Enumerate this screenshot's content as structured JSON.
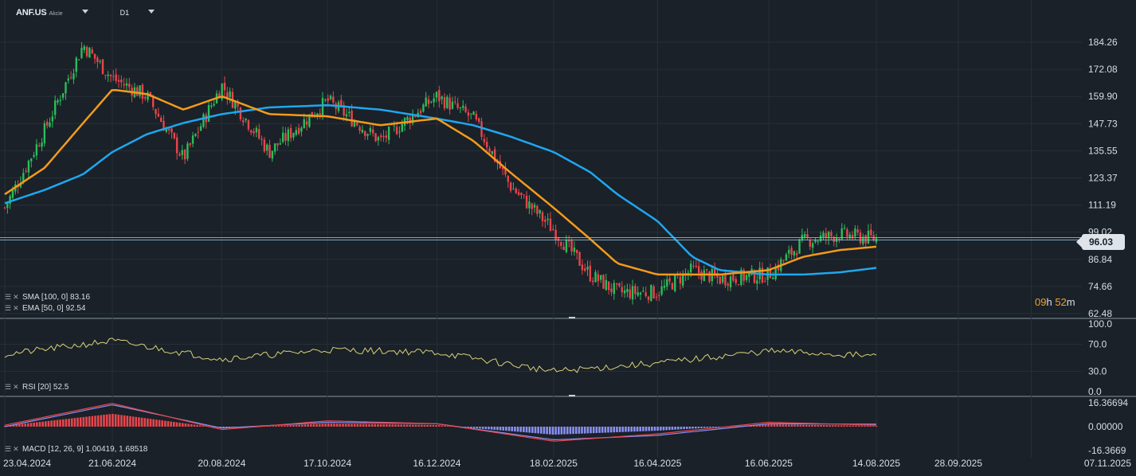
{
  "header": {
    "symbol": "ANF.US",
    "symbol_type": "Akcie",
    "timeframe": "D1"
  },
  "price_panel": {
    "y_ticks": [
      "184.26",
      "172.08",
      "159.90",
      "147.73",
      "135.55",
      "123.37",
      "111.19",
      "99.02",
      "86.84",
      "74.66",
      "62.48"
    ],
    "y_tick_values": [
      184.26,
      172.08,
      159.9,
      147.73,
      135.55,
      123.37,
      111.19,
      99.02,
      86.84,
      74.66,
      62.48
    ],
    "current_price": "96.03",
    "current_price_value": 96.03,
    "countdown_h": "09",
    "countdown_h_unit": "h",
    "countdown_m": "52",
    "countdown_m_unit": "m",
    "sma_label": "SMA [100, 0] 83.16",
    "ema_label": "EMA [50, 0] 92.54"
  },
  "rsi_panel": {
    "y_ticks": [
      "100.0",
      "70.0",
      "30.0",
      "0.0"
    ],
    "y_tick_values": [
      100,
      70,
      30,
      0
    ],
    "label": "RSI [20] 52.5"
  },
  "macd_panel": {
    "y_ticks": [
      "16.36694",
      "0.00000",
      "-16.3669"
    ],
    "y_tick_values": [
      16.36694,
      0,
      -16.3669
    ],
    "label": "MACD [12, 26, 9] 1.00419, 1.68518"
  },
  "x_ticks": [
    "23.04.2024",
    "21.06.2024",
    "20.08.2024",
    "17.10.2024",
    "16.12.2024",
    "18.02.2025",
    "16.04.2025",
    "16.06.2025",
    "14.08.2025",
    "28.09.2025",
    "07.11.2025"
  ],
  "colors": {
    "background": "#1a2128",
    "grid": "#263039",
    "up": "#2bbd5a",
    "down": "#e8454c",
    "sma": "#1ea7f0",
    "ema": "#f39a1c",
    "rsi": "#d8d27a",
    "macd_line": "#e8454c",
    "signal_line": "#8a8ff0",
    "hist_pos": "#e8454c",
    "hist_neg": "#8a8ff0",
    "countdown": "#f0a030"
  },
  "chart_data": [
    {
      "type": "line",
      "panel": "price",
      "x": [
        "2024-04-23",
        "2024-05-15",
        "2024-06-05",
        "2024-06-21",
        "2024-07-10",
        "2024-07-30",
        "2024-08-20",
        "2024-09-15",
        "2024-10-17",
        "2024-11-15",
        "2024-12-16",
        "2025-01-05",
        "2025-01-25",
        "2025-02-18",
        "2025-03-10",
        "2025-03-25",
        "2025-04-16",
        "2025-05-05",
        "2025-05-20",
        "2025-06-16",
        "2025-07-05",
        "2025-07-25",
        "2025-08-14"
      ],
      "series": [
        {
          "name": "Close",
          "values": [
            110,
            145,
            183,
            168,
            160,
            132,
            165,
            135,
            158,
            140,
            160,
            150,
            120,
            100,
            80,
            72,
            72,
            82,
            78,
            80,
            95,
            98,
            96
          ]
        },
        {
          "name": "SMA [100, 0]",
          "values": [
            112,
            118,
            125,
            135,
            143,
            148,
            152,
            155,
            156,
            154,
            150,
            147,
            142,
            135,
            126,
            116,
            104,
            88,
            82,
            80,
            80,
            81,
            83
          ]
        },
        {
          "name": "EMA [50, 0]",
          "values": [
            116,
            128,
            148,
            163,
            161,
            154,
            160,
            152,
            151,
            147,
            150,
            140,
            126,
            110,
            96,
            85,
            80,
            80,
            80,
            82,
            88,
            91,
            92.5
          ]
        }
      ],
      "ylim": [
        62.48,
        190
      ]
    },
    {
      "type": "line",
      "panel": "rsi",
      "x": [
        "2024-04-23",
        "2024-06-21",
        "2024-08-20",
        "2024-10-17",
        "2024-12-16",
        "2025-02-18",
        "2025-04-16",
        "2025-06-16",
        "2025-08-14"
      ],
      "values": [
        55,
        75,
        48,
        62,
        58,
        30,
        42,
        60,
        52.5
      ],
      "ylim": [
        0,
        100
      ]
    },
    {
      "type": "line",
      "panel": "macd",
      "x": [
        "2024-04-23",
        "2024-06-21",
        "2024-08-20",
        "2024-10-17",
        "2024-12-16",
        "2025-02-18",
        "2025-04-16",
        "2025-06-16",
        "2025-08-14"
      ],
      "series": [
        {
          "name": "MACD",
          "values": [
            1,
            16,
            -2,
            4,
            2,
            -10,
            -5,
            3,
            1.00419
          ]
        },
        {
          "name": "Signal",
          "values": [
            0,
            15,
            -1,
            3,
            2,
            -9,
            -6,
            2,
            1.68518
          ]
        }
      ],
      "ylim": [
        -16.3669,
        16.36694
      ]
    }
  ]
}
